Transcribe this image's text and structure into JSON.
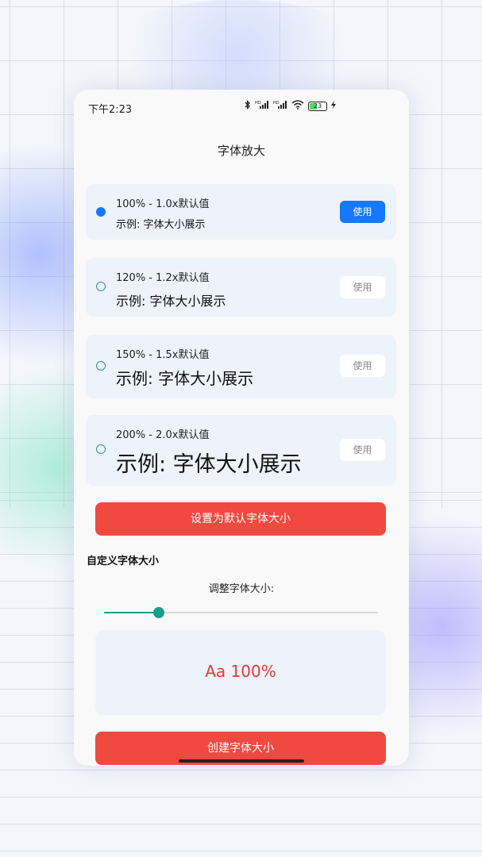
{
  "status_bar": {
    "time": "下午2:23",
    "battery": "23",
    "icons": [
      "bluetooth-icon",
      "hd-signal-icon",
      "hd-signal-icon",
      "wifi-icon",
      "battery-icon",
      "charging-icon"
    ]
  },
  "page": {
    "title": "字体放大"
  },
  "options": [
    {
      "label": "100% - 1.0x默认值",
      "sample": "示例: 字体大小展示",
      "button": "使用",
      "selected": true,
      "scale": 1.0
    },
    {
      "label": "120% - 1.2x默认值",
      "sample": "示例: 字体大小展示",
      "button": "使用",
      "selected": false,
      "scale": 1.2
    },
    {
      "label": "150% - 1.5x默认值",
      "sample": "示例: 字体大小展示",
      "button": "使用",
      "selected": false,
      "scale": 1.5
    },
    {
      "label": "200% - 2.0x默认值",
      "sample": "示例: 字体大小展示",
      "button": "使用",
      "selected": false,
      "scale": 2.0
    }
  ],
  "set_default_button": "设置为默认字体大小",
  "custom": {
    "section_title": "自定义字体大小",
    "adjust_label": "调整字体大小:",
    "slider_value": 0.2,
    "preview_text": "Aa 100%",
    "create_button": "创建字体大小"
  },
  "colors": {
    "primary": "#1677ff",
    "danger": "#f04a40",
    "slider": "#1c9a8e",
    "preview_text": "#e53a32",
    "card_bg": "#eef2fb"
  }
}
